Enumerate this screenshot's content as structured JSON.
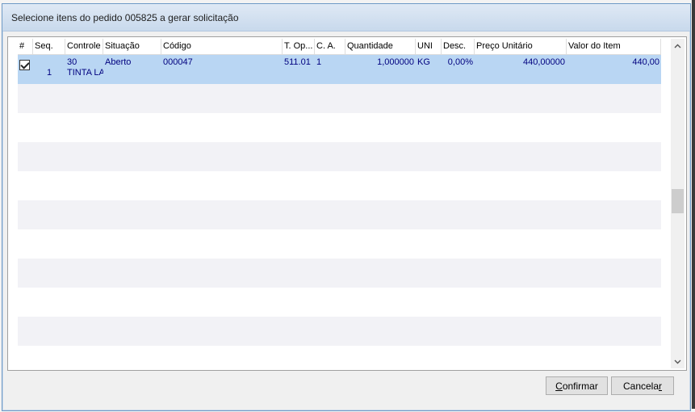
{
  "dialog": {
    "title": "Selecione itens do pedido 005825 a gerar solicitação"
  },
  "table": {
    "columns": [
      "#",
      "Seq.",
      "Controle",
      "Situação",
      "Código",
      "T. Op...",
      "C. A.",
      "Quantidade",
      "UNI",
      "Desc.",
      "Preço Unitário",
      "Valor do Item"
    ],
    "rows": [
      {
        "checked": true,
        "seq": "1",
        "controle_line1": "30",
        "controle_line2": "TINTA LA",
        "situacao": "Aberto",
        "codigo": "000047",
        "t_op": "511.01",
        "ca": "1",
        "quantidade": "1,000000",
        "uni": "KG",
        "desc": "0,00%",
        "preco_unitario": "440,00000",
        "valor_item": "440,00"
      }
    ]
  },
  "buttons": {
    "confirm_prefix": "C",
    "confirm_rest": "onfirmar",
    "cancel_prefix": "Cancela",
    "cancel_under": "r"
  }
}
